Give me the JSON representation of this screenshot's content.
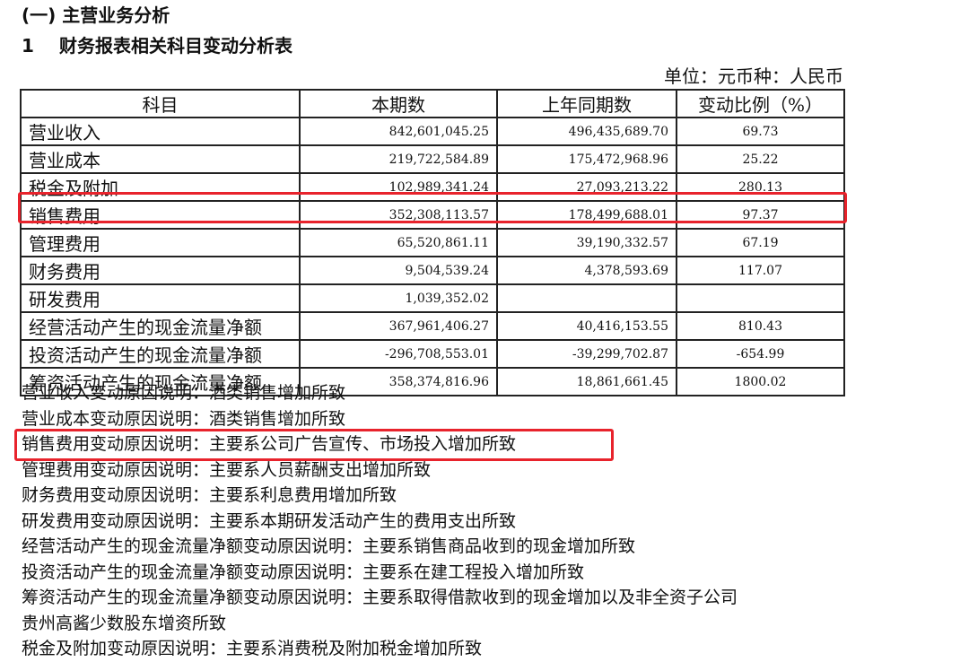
{
  "heading": {
    "section": "(一)  主营业务分析",
    "sub_num": "1",
    "sub_title": "财务报表相关科目变动分析表"
  },
  "unit_line": "单位：元币种：人民币",
  "table": {
    "headers": [
      "科目",
      "本期数",
      "上年同期数",
      "变动比例（%）"
    ],
    "rows": [
      [
        "营业收入",
        "842,601,045.25",
        "496,435,689.70",
        "69.73"
      ],
      [
        "营业成本",
        "219,722,584.89",
        "175,472,968.96",
        "25.22"
      ],
      [
        "税金及附加",
        "102,989,341.24",
        "27,093,213.22",
        "280.13"
      ],
      [
        "销售费用",
        "352,308,113.57",
        "178,499,688.01",
        "97.37"
      ],
      [
        "管理费用",
        "65,520,861.11",
        "39,190,332.57",
        "67.19"
      ],
      [
        "财务费用",
        "9,504,539.24",
        "4,378,593.69",
        "117.07"
      ],
      [
        "研发费用",
        "1,039,352.02",
        "",
        ""
      ],
      [
        "经营活动产生的现金流量净额",
        "367,961,406.27",
        "40,416,153.55",
        "810.43"
      ],
      [
        "投资活动产生的现金流量净额",
        "-296,708,553.01",
        "-39,299,702.87",
        "-654.99"
      ],
      [
        "筹资活动产生的现金流量净额",
        "358,374,816.96",
        "18,861,661.45",
        "1800.02"
      ]
    ]
  },
  "notes": [
    "营业收入变动原因说明：酒类销售增加所致",
    "营业成本变动原因说明：酒类销售增加所致",
    "销售费用变动原因说明：主要系公司广告宣传、市场投入增加所致",
    "管理费用变动原因说明：主要系人员薪酬支出增加所致",
    "财务费用变动原因说明：主要系利息费用增加所致",
    "研发费用变动原因说明：主要系本期研发活动产生的费用支出所致",
    "经营活动产生的现金流量净额变动原因说明：主要系销售商品收到的现金增加所致",
    "投资活动产生的现金流量净额变动原因说明：主要系在建工程投入增加所致",
    "筹资活动产生的现金流量净额变动原因说明：主要系取得借款收到的现金增加以及非全资子公司",
    "贵州高酱少数股东增资所致",
    "税金及附加变动原因说明：主要系消费税及附加税金增加所致"
  ],
  "colors": {
    "highlight": "#e8232c",
    "border": "#222222"
  }
}
